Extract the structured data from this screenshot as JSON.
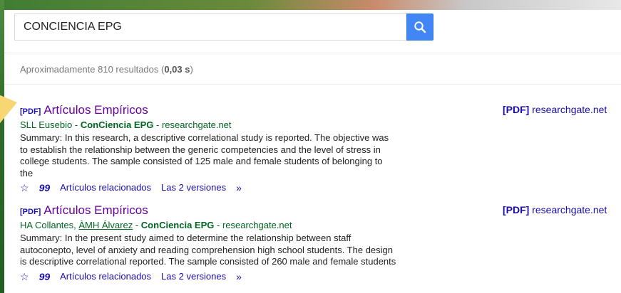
{
  "search": {
    "query": "CONCIENCIA EPG"
  },
  "stats": {
    "prefix": "Aproximadamente 810 resultados (",
    "time": "0,03 s",
    "suffix": ")"
  },
  "results": [
    {
      "tag": "[PDF]",
      "title": "Artículos Empíricos",
      "authors": "SLL Eusebio",
      "author_link": "",
      "sep1": " - ",
      "journal": "ConCiencia EPG",
      "sep2": " - ",
      "source": "researchgate.net",
      "snippet": "Summary: In this research, a descriptive correlational study is reported. The objective was to establish the relationship between the generic competencies and the level of stress in college students. The sample consisted of 125 male and female students of belonging to the",
      "related": "Artículos relacionados",
      "versions": "Las 2 versiones",
      "side_tag": "[PDF]",
      "side_source": "researchgate.net"
    },
    {
      "tag": "[PDF]",
      "title": "Artículos Empíricos",
      "authors": "HA Collantes, ",
      "author_link": "ÀMH Álvarez",
      "sep1": " - ",
      "journal": "ConCiencia EPG",
      "sep2": " - ",
      "source": "researchgate.net",
      "snippet": "Summary: In the present study aimed to determine the relationship between staff autoconepto, level of anxiety and reading comprehension high school students. The design is descriptive correlational reported. The sample consisted of 260 male and female students",
      "related": "Artículos relacionados",
      "versions": "Las 2 versiones",
      "side_tag": "[PDF]",
      "side_source": "researchgate.net"
    }
  ],
  "icons": {
    "search": "search-icon",
    "save": "star-icon",
    "cite": "quote-icon",
    "more": "double-chevron-icon"
  },
  "colors": {
    "accent": "#4285f4",
    "visited_title": "#660099",
    "link": "#1a0dab",
    "source_green": "#006621"
  }
}
